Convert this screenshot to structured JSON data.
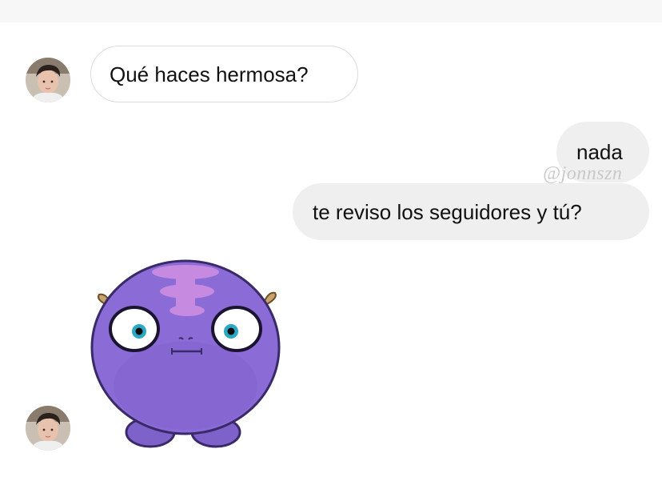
{
  "messages": [
    {
      "sender": "them",
      "text": "Qué haces hermosa?"
    },
    {
      "sender": "me",
      "text": "nada"
    },
    {
      "sender": "me",
      "text": "te reviso los seguidores y tú?"
    }
  ],
  "watermark": "@jonnszn",
  "sticker": {
    "name": "purple-monster-sticker",
    "body_color": "#8b6bd6"
  },
  "colors": {
    "incoming_bubble_border": "#dbdbdb",
    "outgoing_bubble_bg": "#efefef",
    "text": "#111111"
  }
}
